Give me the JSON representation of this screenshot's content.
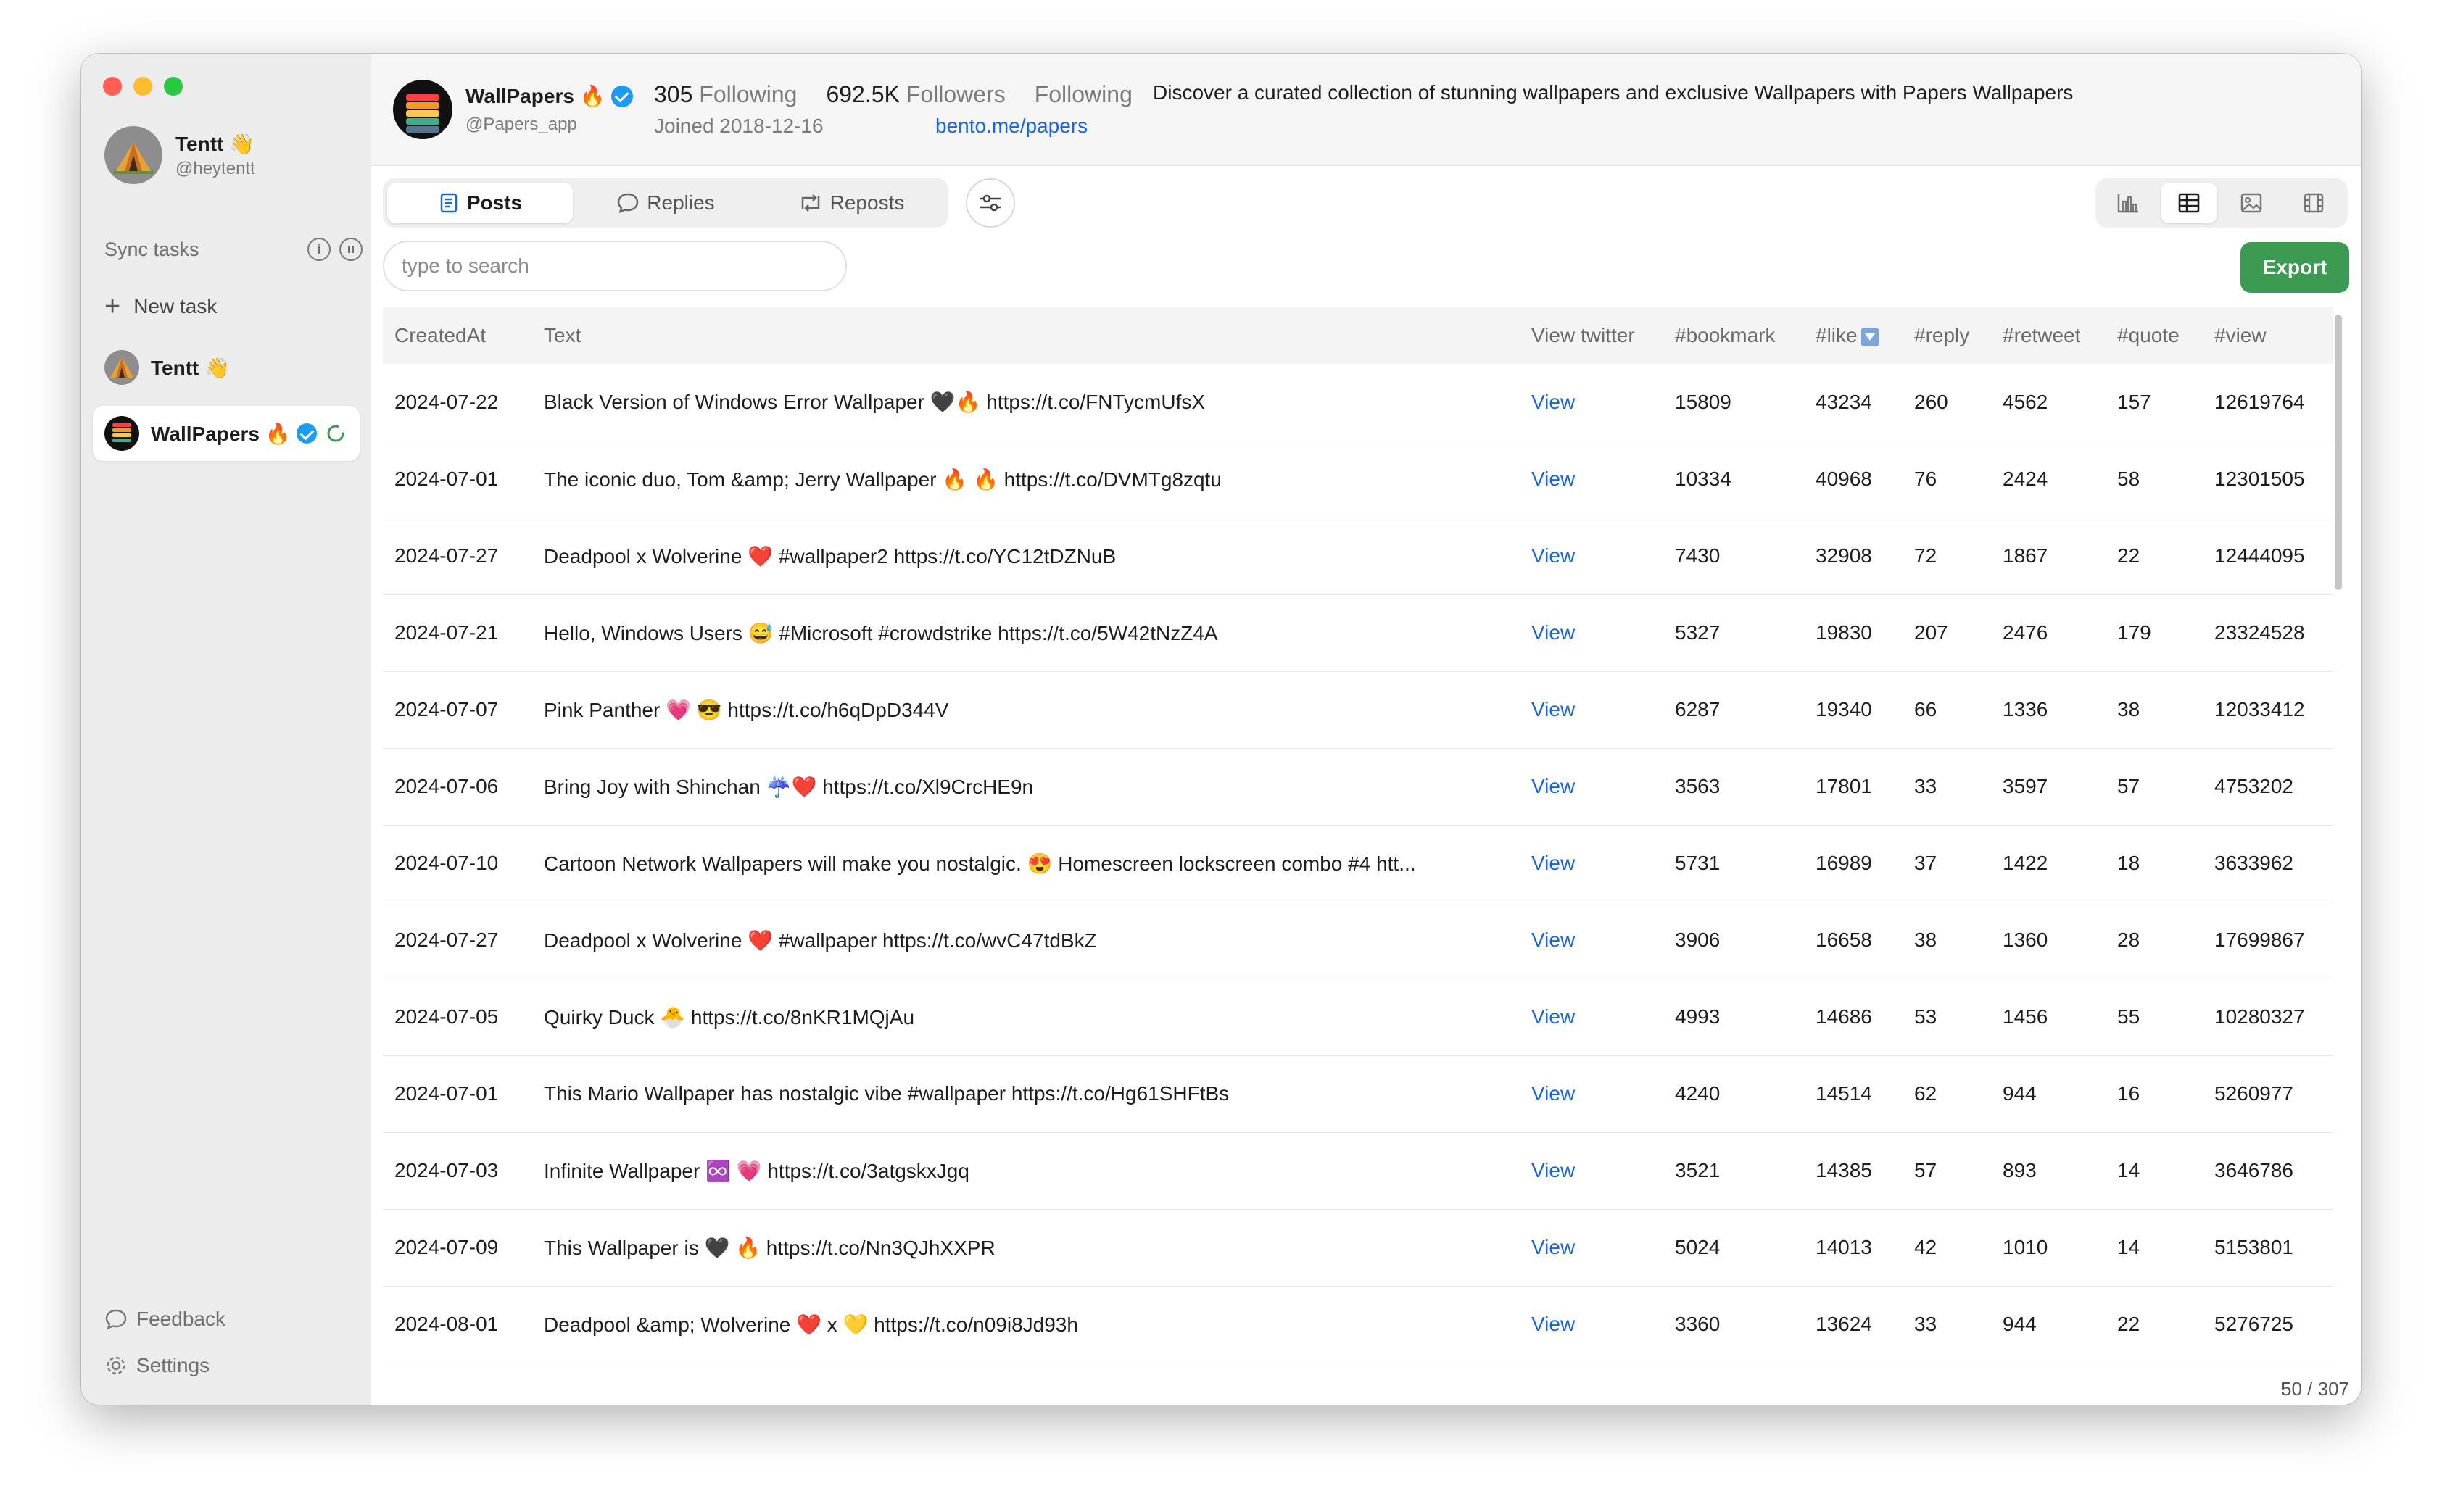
{
  "app": {
    "user": {
      "name": "Tentt 👋",
      "handle": "@heytentt"
    },
    "sync_tasks_label": "Sync tasks",
    "new_task_label": "New task",
    "tasks": [
      {
        "name": "Tentt 👋"
      },
      {
        "name": "WallPapers 🔥"
      }
    ],
    "feedback_label": "Feedback",
    "settings_label": "Settings"
  },
  "account": {
    "name": "WallPapers 🔥",
    "handle": "@Papers_app",
    "following_count": "305",
    "following_label": "Following",
    "followers_count": "692.5K",
    "followers_label": "Followers",
    "relationship": "Following",
    "joined": "Joined 2018-12-16",
    "website": "bento.me/papers",
    "bio": "Discover a curated collection of stunning wallpapers and exclusive Wallpapers with Papers Wallpapers"
  },
  "tabs": [
    {
      "label": "Posts",
      "active": true
    },
    {
      "label": "Replies",
      "active": false
    },
    {
      "label": "Reposts",
      "active": false
    }
  ],
  "view_modes": [
    {
      "icon": "bar-chart-icon",
      "active": false
    },
    {
      "icon": "table-icon",
      "active": true
    },
    {
      "icon": "image-icon",
      "active": false
    },
    {
      "icon": "film-icon",
      "active": false
    }
  ],
  "search": {
    "placeholder": "type to search"
  },
  "export_label": "Export",
  "table": {
    "columns": [
      "CreatedAt",
      "Text",
      "View twitter",
      "#bookmark",
      "#like",
      "#reply",
      "#retweet",
      "#quote",
      "#view"
    ],
    "view_label": "View",
    "rows": [
      {
        "created": "2024-07-22",
        "text": "Black Version of Windows Error Wallpaper 🖤🔥 https://t.co/FNTycmUfsX",
        "bookmark": "15809",
        "like": "43234",
        "reply": "260",
        "retweet": "4562",
        "quote": "157",
        "view": "12619764"
      },
      {
        "created": "2024-07-01",
        "text": "The iconic duo, Tom &amp; Jerry Wallpaper 🔥 🔥 https://t.co/DVMTg8zqtu",
        "bookmark": "10334",
        "like": "40968",
        "reply": "76",
        "retweet": "2424",
        "quote": "58",
        "view": "12301505"
      },
      {
        "created": "2024-07-27",
        "text": "Deadpool x Wolverine ❤️ #wallpaper2 https://t.co/YC12tDZNuB",
        "bookmark": "7430",
        "like": "32908",
        "reply": "72",
        "retweet": "1867",
        "quote": "22",
        "view": "12444095"
      },
      {
        "created": "2024-07-21",
        "text": "Hello, Windows Users 😅 #Microsoft #crowdstrike https://t.co/5W42tNzZ4A",
        "bookmark": "5327",
        "like": "19830",
        "reply": "207",
        "retweet": "2476",
        "quote": "179",
        "view": "23324528"
      },
      {
        "created": "2024-07-07",
        "text": "Pink Panther 💗 😎 https://t.co/h6qDpD344V",
        "bookmark": "6287",
        "like": "19340",
        "reply": "66",
        "retweet": "1336",
        "quote": "38",
        "view": "12033412"
      },
      {
        "created": "2024-07-06",
        "text": "Bring Joy with Shinchan ☔❤️ https://t.co/Xl9CrcHE9n",
        "bookmark": "3563",
        "like": "17801",
        "reply": "33",
        "retweet": "3597",
        "quote": "57",
        "view": "4753202"
      },
      {
        "created": "2024-07-10",
        "text": "Cartoon Network Wallpapers will make you nostalgic. 😍 Homescreen lockscreen combo #4 htt...",
        "bookmark": "5731",
        "like": "16989",
        "reply": "37",
        "retweet": "1422",
        "quote": "18",
        "view": "3633962"
      },
      {
        "created": "2024-07-27",
        "text": "Deadpool x Wolverine ❤️ #wallpaper https://t.co/wvC47tdBkZ",
        "bookmark": "3906",
        "like": "16658",
        "reply": "38",
        "retweet": "1360",
        "quote": "28",
        "view": "17699867"
      },
      {
        "created": "2024-07-05",
        "text": "Quirky Duck 🐣 https://t.co/8nKR1MQjAu",
        "bookmark": "4993",
        "like": "14686",
        "reply": "53",
        "retweet": "1456",
        "quote": "55",
        "view": "10280327"
      },
      {
        "created": "2024-07-01",
        "text": "This Mario Wallpaper has nostalgic vibe #wallpaper https://t.co/Hg61SHFtBs",
        "bookmark": "4240",
        "like": "14514",
        "reply": "62",
        "retweet": "944",
        "quote": "16",
        "view": "5260977"
      },
      {
        "created": "2024-07-03",
        "text": "Infinite Wallpaper ♾️ 💗 https://t.co/3atgskxJgq",
        "bookmark": "3521",
        "like": "14385",
        "reply": "57",
        "retweet": "893",
        "quote": "14",
        "view": "3646786"
      },
      {
        "created": "2024-07-09",
        "text": "This Wallpaper is 🖤 🔥 https://t.co/Nn3QJhXXPR",
        "bookmark": "5024",
        "like": "14013",
        "reply": "42",
        "retweet": "1010",
        "quote": "14",
        "view": "5153801"
      },
      {
        "created": "2024-08-01",
        "text": "Deadpool &amp; Wolverine ❤️ x 💛 https://t.co/n09i8Jd93h",
        "bookmark": "3360",
        "like": "13624",
        "reply": "33",
        "retweet": "944",
        "quote": "22",
        "view": "5276725"
      }
    ]
  },
  "pagination": "50 / 307",
  "colors": {
    "accent": "#1a66d9",
    "export": "#3d9a52",
    "verified": "#1d9bf0"
  }
}
